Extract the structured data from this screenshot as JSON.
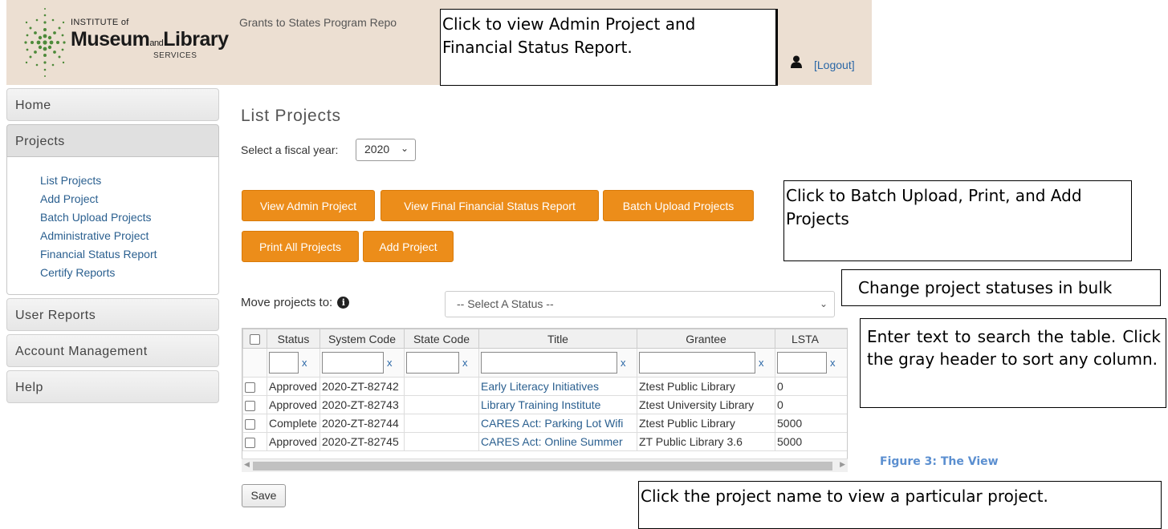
{
  "header": {
    "logo_line1": "INSTITUTE of",
    "logo_line2a": "Museum",
    "logo_line2_and": "and",
    "logo_line2b": "Library",
    "logo_line3": "SERVICES",
    "title": "Grants to States Program Repo",
    "logout": "[Logout]"
  },
  "sidebar": {
    "home": "Home",
    "projects": "Projects",
    "sub_items": [
      "List Projects",
      "Add Project",
      "Batch Upload Projects",
      "Administrative Project",
      "Financial Status Report",
      "Certify Reports"
    ],
    "user_reports": "User Reports",
    "account_management": "Account Management",
    "help": "Help"
  },
  "main": {
    "page_title": "List Projects",
    "fiscal_year_label": "Select a fiscal year:",
    "fiscal_year_value": "2020",
    "buttons": {
      "view_admin": "View Admin Project",
      "view_final_fsr": "View Final Financial Status Report",
      "batch_upload": "Batch Upload Projects",
      "print_all": "Print All Projects",
      "add_project": "Add Project"
    },
    "move_label": "Move projects to:",
    "status_placeholder": "-- Select A Status --",
    "save": "Save"
  },
  "table": {
    "columns": [
      "Status",
      "System Code",
      "State Code",
      "Title",
      "Grantee",
      "LSTA"
    ],
    "filter_clear": "x",
    "rows": [
      {
        "status": "Approved",
        "system_code": "2020-ZT-82742",
        "state_code": "",
        "title": "Early Literacy Initiatives",
        "grantee": "Ztest Public Library",
        "lsta": "0"
      },
      {
        "status": "Approved",
        "system_code": "2020-ZT-82743",
        "state_code": "",
        "title": "Library Training Institute",
        "grantee": "Ztest University Library",
        "lsta": "0"
      },
      {
        "status": "Complete",
        "system_code": "2020-ZT-82744",
        "state_code": "",
        "title": "CARES Act: Parking Lot Wifi",
        "grantee": "Ztest Public Library",
        "lsta": "5000"
      },
      {
        "status": "Approved",
        "system_code": "2020-ZT-82745",
        "state_code": "",
        "title": "CARES Act: Online Summer",
        "grantee": "ZT Public Library 3.6",
        "lsta": "5000"
      }
    ]
  },
  "callouts": {
    "admin": "Click to view Admin Project and Financial Status Report.",
    "batch": "Click to Batch Upload, Print, and Add Projects",
    "status": "Change project statuses in bulk",
    "search": "Enter text to search the table. Click the gray header to sort any column.",
    "project": "Click the project name to view a particular project."
  },
  "figure_caption": "Figure 3: The View",
  "colors": {
    "accent_orange": "#ec8d1a",
    "header_bg": "#ecdfd2",
    "link": "#2a5f8f",
    "caption": "#5b8fd0"
  }
}
